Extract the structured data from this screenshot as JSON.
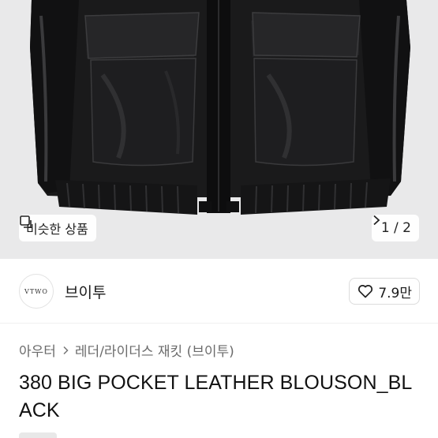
{
  "hero": {
    "similar_label": "비슷한 상품",
    "similar_icon": "copy-icon",
    "pager_text": "1 / 2",
    "pager_icon": "chevron-right-icon",
    "background_color": "#e9e9ea"
  },
  "store": {
    "logo_text": "VTWO",
    "name": "브이투",
    "likes": "7.9만",
    "like_icon": "heart-icon"
  },
  "breadcrumb": {
    "level1": "아우터",
    "level2": "레더/라이더스 재킷 (브이투)",
    "separator_icon": "chevron-right-icon"
  },
  "product": {
    "title": "380 BIG POCKET LEATHER BLOUSON_BLACK"
  }
}
